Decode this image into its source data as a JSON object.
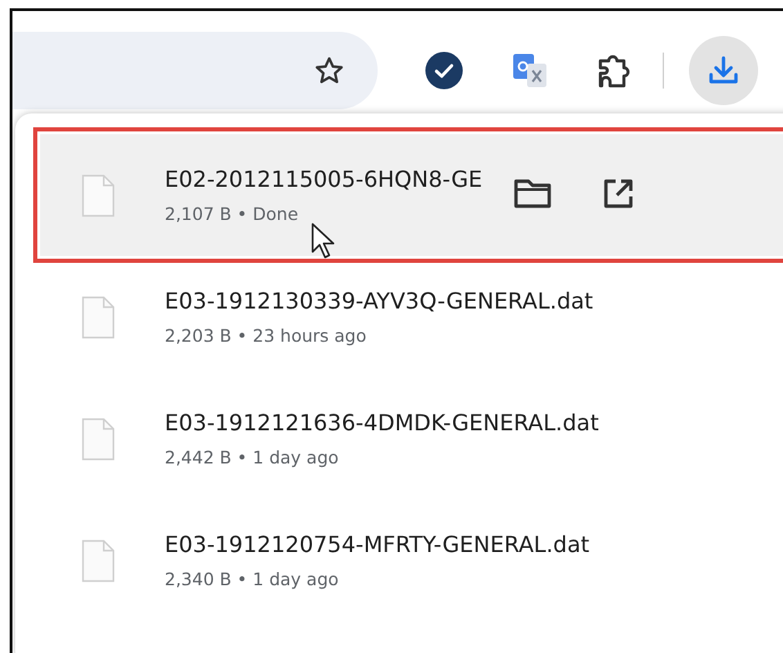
{
  "toolbar": {
    "bookmarked": false
  },
  "downloads": [
    {
      "name": "E02-2012115005-6HQN8-GE",
      "details": "2,107 B • Done",
      "hovered": true,
      "annotated": true
    },
    {
      "name": "E03-1912130339-AYV3Q-GENERAL.dat",
      "details": "2,203 B • 23 hours ago",
      "hovered": false,
      "annotated": false
    },
    {
      "name": "E03-1912121636-4DMDK-GENERAL.dat",
      "details": "2,442 B • 1 day ago",
      "hovered": false,
      "annotated": false
    },
    {
      "name": "E03-1912120754-MFRTY-GENERAL.dat",
      "details": "2,340 B • 1 day ago",
      "hovered": false,
      "annotated": false
    }
  ]
}
